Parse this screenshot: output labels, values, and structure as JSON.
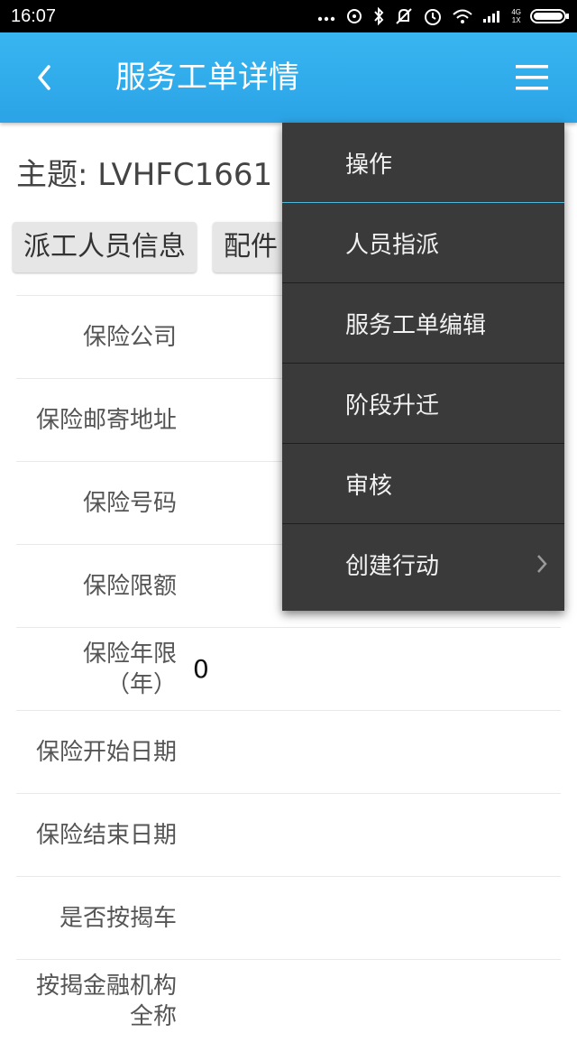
{
  "status_bar": {
    "time": "16:07",
    "network": [
      "4G",
      "1X"
    ],
    "icons": [
      "dots-icon",
      "alarm-icon",
      "bluetooth-icon",
      "mute-icon",
      "clock-icon",
      "wifi-icon",
      "signal-icon",
      "battery-icon"
    ]
  },
  "header": {
    "title": "服务工单详情"
  },
  "subject": {
    "text": "主题: LVHFC1661"
  },
  "tabs": [
    {
      "label": "派工人员信息"
    },
    {
      "label": "配件"
    }
  ],
  "form": {
    "rows": [
      {
        "label": "保险公司",
        "value": ""
      },
      {
        "label": "保险邮寄地址",
        "value": ""
      },
      {
        "label": "保险号码",
        "value": ""
      },
      {
        "label": "保险限额",
        "value": ""
      },
      {
        "label": "保险年限\n（年）",
        "value": "0"
      },
      {
        "label": "保险开始日期",
        "value": ""
      },
      {
        "label": "保险结束日期",
        "value": ""
      },
      {
        "label": "是否按揭车",
        "value": ""
      },
      {
        "label": "按揭金融机构\n全称",
        "value": ""
      }
    ]
  },
  "menu": {
    "header": "操作",
    "items": [
      {
        "label": "人员指派"
      },
      {
        "label": "服务工单编辑"
      },
      {
        "label": "阶段升迁"
      },
      {
        "label": "审核"
      },
      {
        "label": "创建行动"
      }
    ]
  },
  "colors": {
    "app_bar": "#2ba3e6",
    "menu_bg": "#3a3a3a",
    "menu_accent": "#4fb7d8"
  }
}
